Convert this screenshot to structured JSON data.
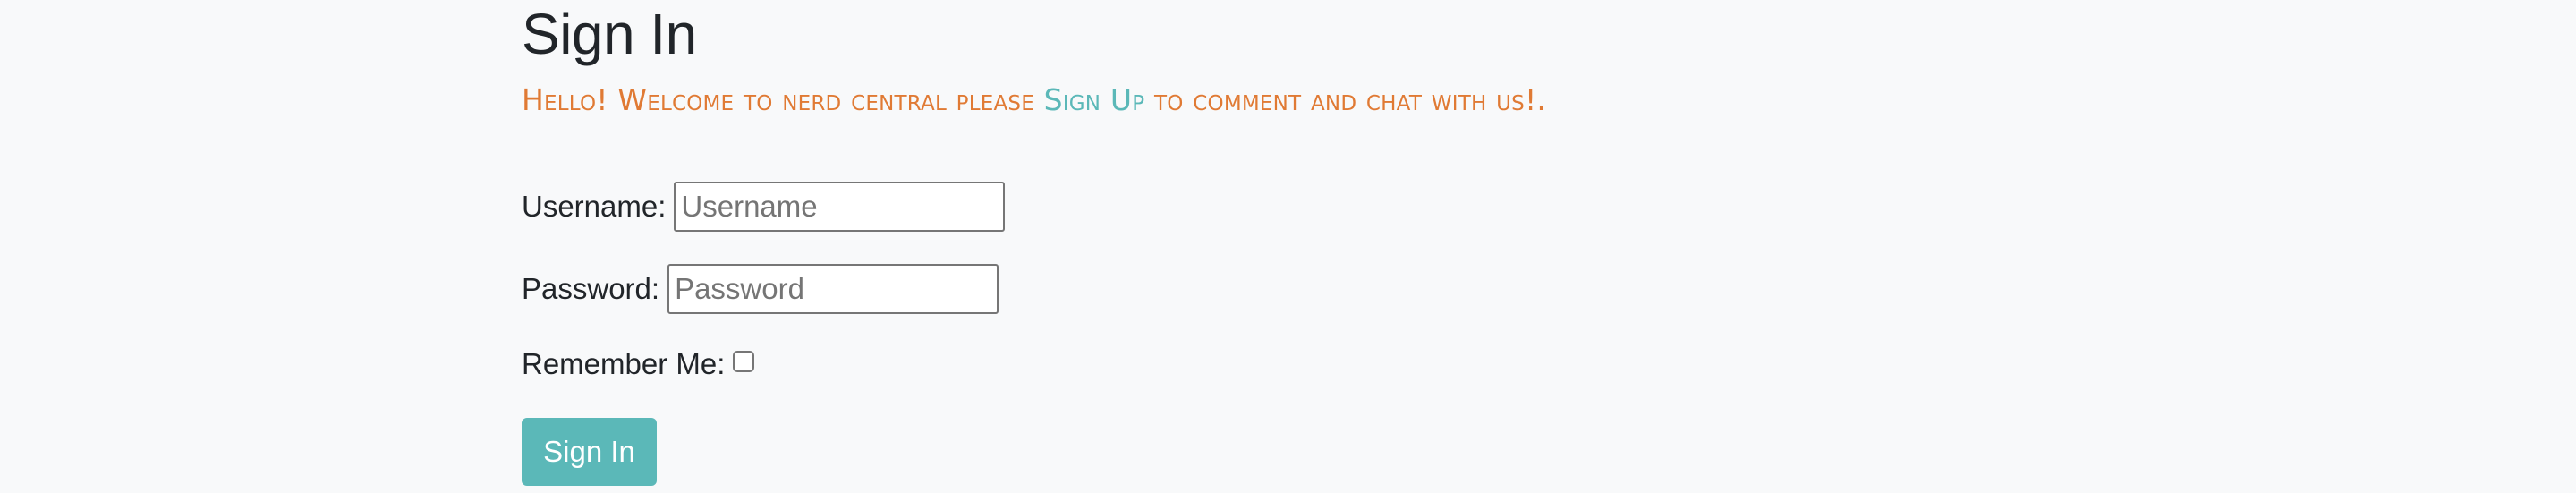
{
  "header": {
    "title": "Sign In"
  },
  "welcome": {
    "prefix": "Hello! Welcome to nerd central please ",
    "signup_link": "Sign Up",
    "suffix": " to comment and chat with us!."
  },
  "form": {
    "username_label": "Username:",
    "username_placeholder": "Username",
    "password_label": "Password:",
    "password_placeholder": "Password",
    "remember_label": "Remember Me:",
    "remember_checked": false,
    "submit_label": "Sign In"
  },
  "colors": {
    "background": "#f8f9fa",
    "accent_text": "#e07a34",
    "link": "#5bb8b8",
    "button": "#5bb8b8"
  }
}
